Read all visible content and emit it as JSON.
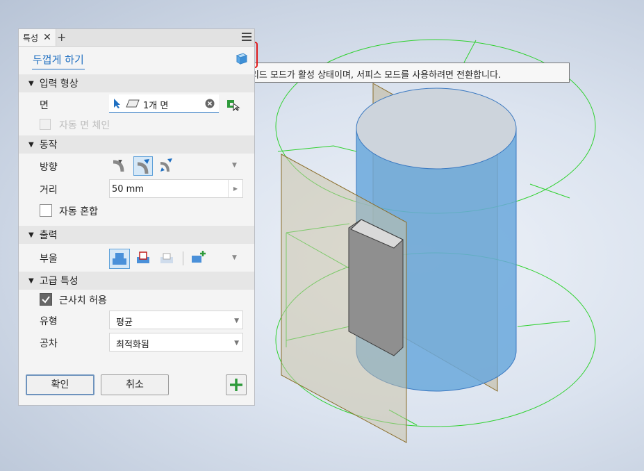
{
  "tab": {
    "label": "특성",
    "close": "✕",
    "add": "+"
  },
  "command_title": "두껍게 하기",
  "tooltip": "솔리드 모드가 활성 상태이며, 서피스 모드를 사용하려면 전환합니다.",
  "sections": {
    "input": "입력 형상",
    "behavior": "동작",
    "output": "출력",
    "advanced": "고급 특성"
  },
  "input": {
    "face_label": "면",
    "face_value": "1개 면",
    "auto_chain_label": "자동 면 체인"
  },
  "behavior": {
    "direction_label": "방향",
    "distance_label": "거리",
    "distance_value": "50 mm",
    "auto_blend_label": "자동 혼합"
  },
  "output": {
    "boolean_label": "부울"
  },
  "advanced": {
    "approx_label": "근사치 허용",
    "type_label": "유형",
    "type_value": "평균",
    "tolerance_label": "공차",
    "tolerance_value": "최적화됨"
  },
  "buttons": {
    "ok": "확인",
    "cancel": "취소"
  },
  "colors": {
    "accent": "#1f6fc1",
    "green_wire": "#2ed12e",
    "cylinder": "#6aa8dc",
    "plane": "#b2ad8e"
  }
}
